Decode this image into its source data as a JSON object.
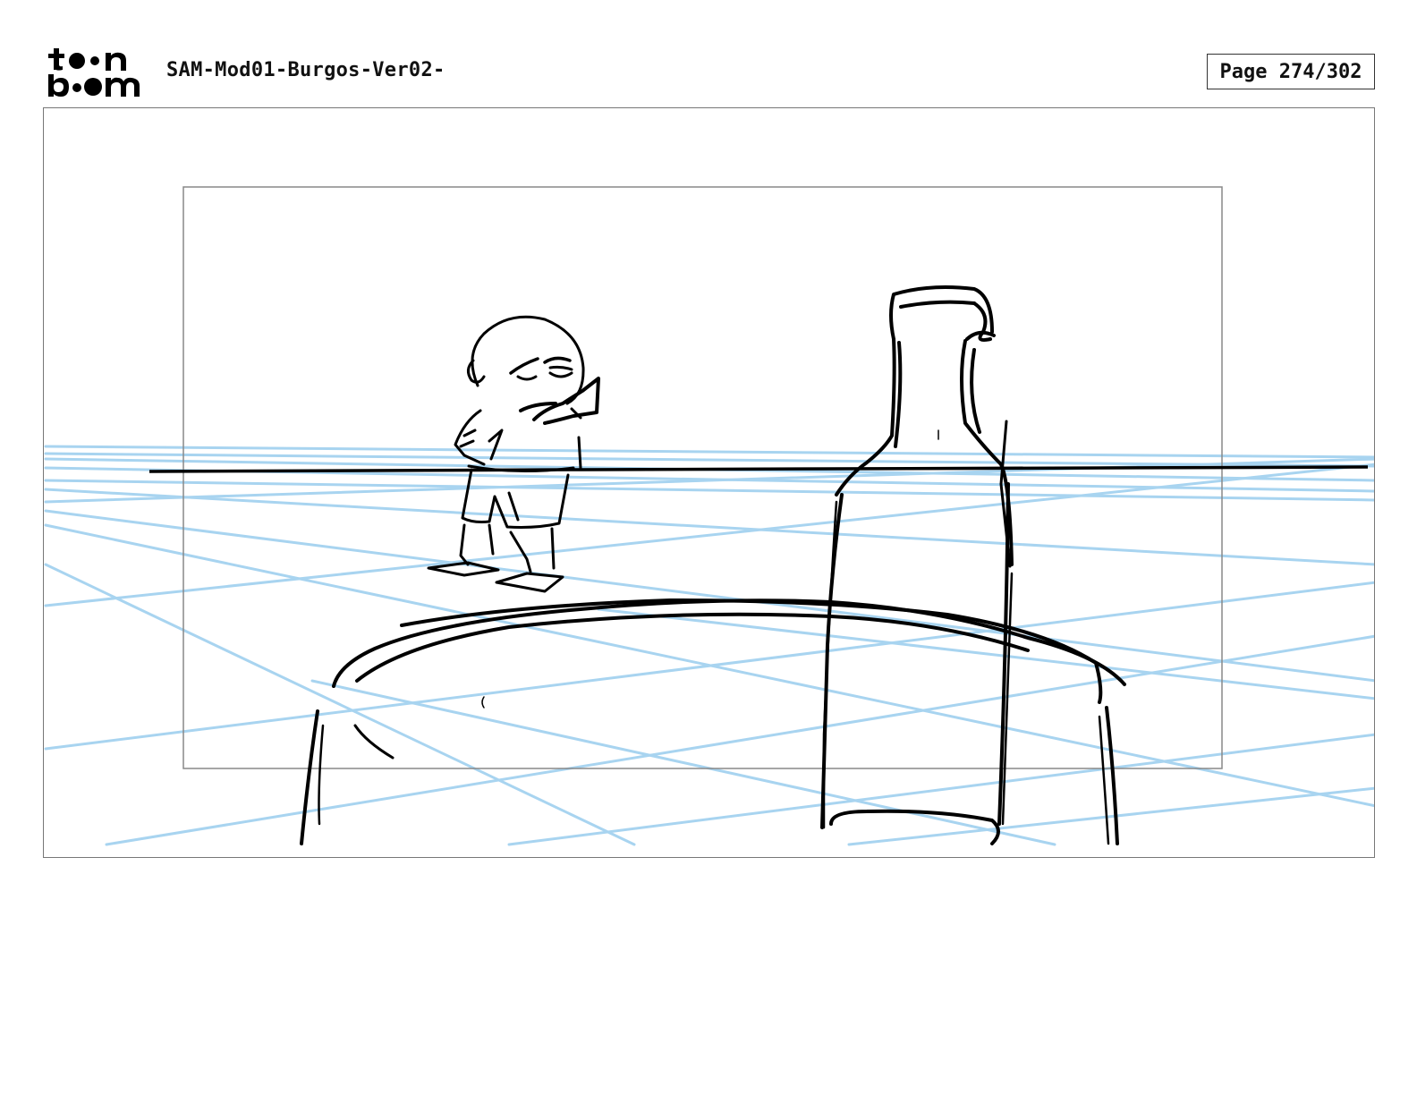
{
  "header": {
    "logo_top": "t••n",
    "logo_bottom": "b••m",
    "logo_name": "toonboom-logo",
    "document_title": "SAM-Mod01-Burgos-Ver02-",
    "page_label": "Page 274/302"
  },
  "panel": {
    "drawing_style": "rough storyboard sketch",
    "guide_color": "#a8d4f0",
    "ink_color": "#000000",
    "safe_frame_color": "#888888"
  }
}
